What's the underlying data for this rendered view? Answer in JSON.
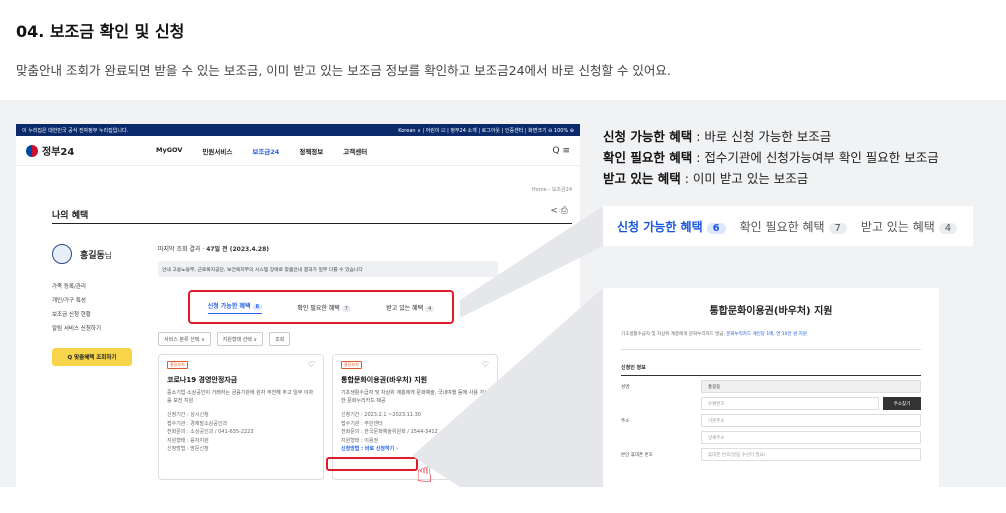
{
  "heading": "04. 보조금 확인 및 신청",
  "subtitle": "맞춤안내 조회가 완료되면 받을 수 있는 보조금, 이미 받고 있는 보조금 정보를 확인하고 보조금24에서 바로 신청할 수 있어요.",
  "gov_banner": {
    "left": "이 누리집은 대한민국 공식 전자정부 누리집입니다.",
    "right": "Korean ∨ | 어린이 ☑ | 정부24 소개 | 로그아웃 | 인증센터 | 화면크기 ⊖ 100% ⊕"
  },
  "nav": {
    "logo": "정부24",
    "menu": [
      "MyGOV",
      "민원서비스",
      "보조금24",
      "정책정보",
      "고객센터"
    ],
    "icons": "Q ≡"
  },
  "crumb": "Home › 보조금24",
  "page_title": "나의 혜택",
  "page_icons": "< ⎙",
  "user": {
    "name": "홍길동",
    "suffix": "님"
  },
  "side_items": [
    "가족 등록/관리",
    "개인/가구 특성",
    "보조금 신청 현황",
    "알림 서비스  신청하기"
  ],
  "side_button": "Q 맞춤혜택 조회하기",
  "last_result": {
    "label": "마지막 조회 결과 · ",
    "value": "47일 전 (2023.4.28)"
  },
  "notice": "안내  고용노동부, 근로복지공단, 보건복지부의 시스템 장애로 맞춤안내 결과가 일부 다를 수 있습니다",
  "tabs": [
    {
      "label": "신청 가능한 혜택",
      "count": "6",
      "active": true
    },
    {
      "label": "확인 필요한 혜택",
      "count": "7"
    },
    {
      "label": "받고 있는 혜택",
      "count": "4"
    }
  ],
  "filters": [
    "서비스 분류 선택  ∨",
    "지원형태 선택  ∨",
    "조회"
  ],
  "cards": [
    {
      "tag": "홍장부처",
      "title": "코로나19 경영안정자금",
      "desc": "중소기업·소상공인이 거래하는 금융기관에 원자 주천해 주고 일부 이자를 보전 지원",
      "lines": [
        "신청기간 : 상시신청",
        "접수기관 : 경제발소상공인과",
        "전화문의 : 소상공인과 / 041-635-2223",
        "지원형태 : 융자지원",
        "신청방법 : 방문신청"
      ]
    },
    {
      "tag": "홍장부처",
      "title": "통합문화이용권(바우처) 지원",
      "desc": "기초생활수급자 및 차상위 계층에게 문화예술, 국내여행 등에 사용 가능한 문화누리카드 제공",
      "lines": [
        "신청기간 : 2023.2.1 ~2023.11.30",
        "접수기관 : 주민센터",
        "전화문의 : 한국문화예술위원회 / 1544-3412",
        "지원형태 : 이용권"
      ],
      "apply": "신청방법 : 바로 신청하기 ›"
    }
  ],
  "legend": [
    {
      "k": "신청 가능한 혜택",
      "v": " : 바로 신청 가능한 보조금"
    },
    {
      "k": "확인 필요한 혜택",
      "v": " : 접수기관에 신청가능여부 확인 필요한 보조금"
    },
    {
      "k": "받고 있는 혜택",
      "v": " : 이미 받고 있는 보조금"
    }
  ],
  "callout_tabs": [
    {
      "label": "신청 가능한 혜택",
      "count": "6",
      "active": true
    },
    {
      "label": "확인 필요한 혜택",
      "count": "7"
    },
    {
      "label": "받고 있는 혜택",
      "count": "4"
    }
  ],
  "form": {
    "title": "통합문화이용권(바우처) 지원",
    "desc": "기초생활수급자 및 차상위 계층에게 문화누리카드 발급,",
    "link": "문화누리카드 개인당 1매, 연 10만 원 지원",
    "section": "신청인 정보",
    "rows": [
      {
        "k": "성명",
        "v": "홍길동",
        "gray": true
      },
      {
        "k": "",
        "v": "우편번호",
        "btn": "주소찾기"
      },
      {
        "k": "주소",
        "v": "기본주소"
      },
      {
        "k": "",
        "v": "상세주소"
      },
      {
        "k": "본인 휴대폰 번호",
        "v": "휴대폰 번호(알림 수신이 필요)"
      }
    ]
  }
}
